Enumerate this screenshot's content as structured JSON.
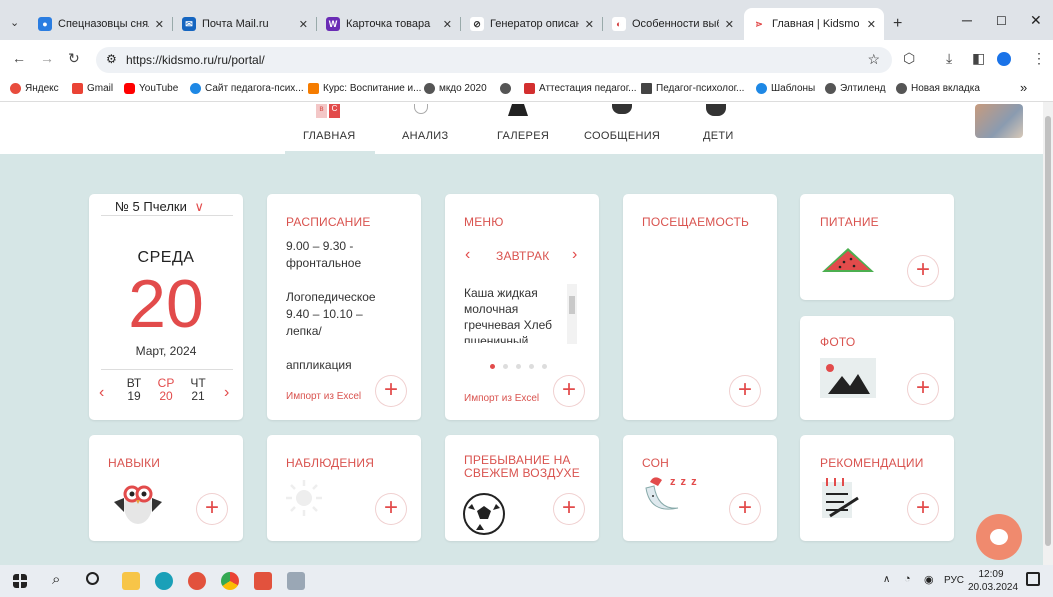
{
  "browser": {
    "tabs": [
      {
        "title": "Спецназовцы сняли",
        "fav_color": "#2a7de1",
        "fav_glyph": "●"
      },
      {
        "title": "Почта Mail.ru",
        "fav_color": "#1565c0",
        "fav_glyph": "✉"
      },
      {
        "title": "Карточка товара",
        "fav_color": "#6a2cb5",
        "fav_glyph": "W"
      },
      {
        "title": "Генератор описани",
        "fav_color": "#333333",
        "fav_glyph": "⊘"
      },
      {
        "title": "Особенности выбор",
        "fav_color": "#d23b3b",
        "fav_glyph": "◐"
      },
      {
        "title": "Главная | Kidsmo",
        "fav_color": "#e24b4b",
        "fav_glyph": "⋗"
      }
    ],
    "new_tab": "+",
    "url": "https://kidsmo.ru/ru/portal/",
    "bookmarks": [
      {
        "label": "Яндекс",
        "color": "#e84c3d"
      },
      {
        "label": "Gmail",
        "color": "#ea4335"
      },
      {
        "label": "YouTube",
        "color": "#ff0000"
      },
      {
        "label": "Сайт педагога-псих...",
        "color": "#1e88e5"
      },
      {
        "label": "Курс: Воспитание и...",
        "color": "#f57c00"
      },
      {
        "label": "мкдо 2020",
        "color": "#555555"
      },
      {
        "label": "",
        "color": "#555555"
      },
      {
        "label": "Аттестация педагог...",
        "color": "#d32f2f"
      },
      {
        "label": "Педагог-психолог...",
        "color": "#444444"
      },
      {
        "label": "Шаблоны",
        "color": "#1e88e5"
      },
      {
        "label": "Элтиленд",
        "color": "#555555"
      },
      {
        "label": "Новая вкладка",
        "color": "#555555"
      }
    ],
    "more": "»"
  },
  "nav": {
    "items": [
      "ГЛАВНАЯ",
      "АНАЛИЗ",
      "ГАЛЕРЕЯ",
      "СООБЩЕНИЯ",
      "ДЕТИ"
    ],
    "active": "ГЛАВНАЯ"
  },
  "calendar": {
    "group": "№ 5 Пчелки",
    "weekday": "СРЕДА",
    "day": "20",
    "month_year": "Март, 2024",
    "days": [
      {
        "wd": "ВТ",
        "d": "19"
      },
      {
        "wd": "СР",
        "d": "20"
      },
      {
        "wd": "ЧТ",
        "d": "21"
      }
    ]
  },
  "schedule": {
    "title": "РАСПИСАНИЕ",
    "lines": [
      "9.00 – 9.30 -",
      "фронтальное",
      "",
      "Логопедическое",
      "9.40 – 10.10 –",
      "лепка/",
      "",
      "аппликация"
    ],
    "import": "Импорт из Excel"
  },
  "menu": {
    "title": "МЕНЮ",
    "meal": "ЗАВТРАК",
    "lines": [
      "Каша жидкая",
      "молочная",
      "гречневая Хлеб",
      "пшеничный"
    ],
    "import": "Импорт из Excel"
  },
  "attendance": {
    "title": "ПОСЕЩАЕМОСТЬ"
  },
  "nutrition": {
    "title": "ПИТАНИЕ"
  },
  "photo": {
    "title": "ФОТО"
  },
  "skills": {
    "title": "НАВЫКИ"
  },
  "observations": {
    "title": "НАБЛЮДЕНИЯ"
  },
  "outdoor": {
    "title_1": "ПРЕБЫВАНИЕ НА",
    "title_2": "СВЕЖЕМ ВОЗДУХЕ"
  },
  "sleep": {
    "title": "СОН",
    "zzz": "z z z"
  },
  "recommendations": {
    "title": "РЕКОМЕНДАЦИИ"
  },
  "plus": "+",
  "taskbar": {
    "lang": "РУС",
    "time": "12:09",
    "date": "20.03.2024"
  },
  "colors": {
    "accent": "#e24b4b",
    "page_bg": "#d6e6e6"
  }
}
